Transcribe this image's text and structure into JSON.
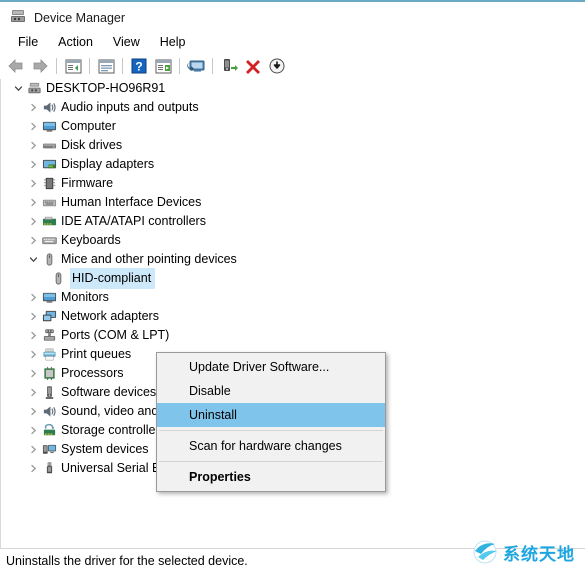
{
  "window": {
    "title": "Device Manager",
    "title_icon": "device-manager-icon"
  },
  "menubar": {
    "items": [
      {
        "label": "File"
      },
      {
        "label": "Action"
      },
      {
        "label": "View"
      },
      {
        "label": "Help"
      }
    ]
  },
  "toolbar": {
    "buttons": [
      {
        "name": "back-icon",
        "tip": "Back"
      },
      {
        "name": "forward-icon",
        "tip": "Forward"
      },
      {
        "name": "separator",
        "tip": ""
      },
      {
        "name": "show-hide-console-tree-icon",
        "tip": "Show/Hide Console Tree"
      },
      {
        "name": "separator",
        "tip": ""
      },
      {
        "name": "properties-icon",
        "tip": "Properties"
      },
      {
        "name": "separator",
        "tip": ""
      },
      {
        "name": "help-icon",
        "tip": "Help"
      },
      {
        "name": "update-driver-icon",
        "tip": "Update Driver Software"
      },
      {
        "name": "separator",
        "tip": ""
      },
      {
        "name": "scan-hardware-changes-icon",
        "tip": "Scan for hardware changes"
      },
      {
        "name": "separator",
        "tip": ""
      },
      {
        "name": "enable-device-icon",
        "tip": "Enable device"
      },
      {
        "name": "uninstall-device-icon",
        "tip": "Uninstall device"
      },
      {
        "name": "disable-device-icon",
        "tip": "Disable device"
      }
    ]
  },
  "tree": {
    "root": {
      "label": "DESKTOP-HO96R91",
      "expanded": true,
      "icon": "computer-root-icon"
    },
    "items": [
      {
        "label": "Audio inputs and outputs",
        "icon": "speaker-icon",
        "expanded": false,
        "level": 1
      },
      {
        "label": "Computer",
        "icon": "monitor-icon",
        "expanded": false,
        "level": 1
      },
      {
        "label": "Disk drives",
        "icon": "disk-drive-icon",
        "expanded": false,
        "level": 1
      },
      {
        "label": "Display adapters",
        "icon": "display-adapter-icon",
        "expanded": false,
        "level": 1
      },
      {
        "label": "Firmware",
        "icon": "firmware-chip-icon",
        "expanded": false,
        "level": 1
      },
      {
        "label": "Human Interface Devices",
        "icon": "hid-icon",
        "expanded": false,
        "level": 1
      },
      {
        "label": "IDE ATA/ATAPI controllers",
        "icon": "ide-controller-icon",
        "expanded": false,
        "level": 1
      },
      {
        "label": "Keyboards",
        "icon": "keyboard-icon",
        "expanded": false,
        "level": 1
      },
      {
        "label": "Mice and other pointing devices",
        "icon": "mouse-icon",
        "expanded": true,
        "level": 1
      },
      {
        "label": "HID-compliant",
        "icon": "mouse-icon",
        "expanded": null,
        "level": 2,
        "selected": true
      },
      {
        "label": "Monitors",
        "icon": "monitor-icon",
        "expanded": false,
        "level": 1
      },
      {
        "label": "Network adapters",
        "icon": "network-adapter-icon",
        "expanded": false,
        "level": 1
      },
      {
        "label": "Ports (COM & LPT)",
        "icon": "port-icon",
        "expanded": false,
        "level": 1
      },
      {
        "label": "Print queues",
        "icon": "printer-icon",
        "expanded": false,
        "level": 1
      },
      {
        "label": "Processors",
        "icon": "processor-icon",
        "expanded": false,
        "level": 1
      },
      {
        "label": "Software devices",
        "icon": "software-device-icon",
        "expanded": false,
        "level": 1
      },
      {
        "label": "Sound, video and game controllers",
        "icon": "speaker-icon",
        "expanded": false,
        "level": 1
      },
      {
        "label": "Storage controllers",
        "icon": "storage-controller-icon",
        "expanded": false,
        "level": 1
      },
      {
        "label": "System devices",
        "icon": "system-device-icon",
        "expanded": false,
        "level": 1
      },
      {
        "label": "Universal Serial Bus controllers",
        "icon": "usb-icon",
        "expanded": false,
        "level": 1
      }
    ]
  },
  "context_menu": {
    "items": [
      {
        "label": "Update Driver Software...",
        "type": "item",
        "highlighted": false,
        "bold": false
      },
      {
        "label": "Disable",
        "type": "item",
        "highlighted": false,
        "bold": false
      },
      {
        "label": "Uninstall",
        "type": "item",
        "highlighted": true,
        "bold": false
      },
      {
        "label": "",
        "type": "separator",
        "highlighted": false,
        "bold": false
      },
      {
        "label": "Scan for hardware changes",
        "type": "item",
        "highlighted": false,
        "bold": false
      },
      {
        "label": "",
        "type": "separator",
        "highlighted": false,
        "bold": false
      },
      {
        "label": "Properties",
        "type": "item",
        "highlighted": false,
        "bold": true
      }
    ]
  },
  "statusbar": {
    "text": "Uninstalls the driver for the selected device."
  },
  "watermark": {
    "text": "系统天地",
    "color": "#1ea6e0"
  },
  "colors": {
    "selection": "#cde8f9",
    "menu_highlight": "#7fc4ea",
    "titlebar_accent": "#6aa9c4"
  }
}
